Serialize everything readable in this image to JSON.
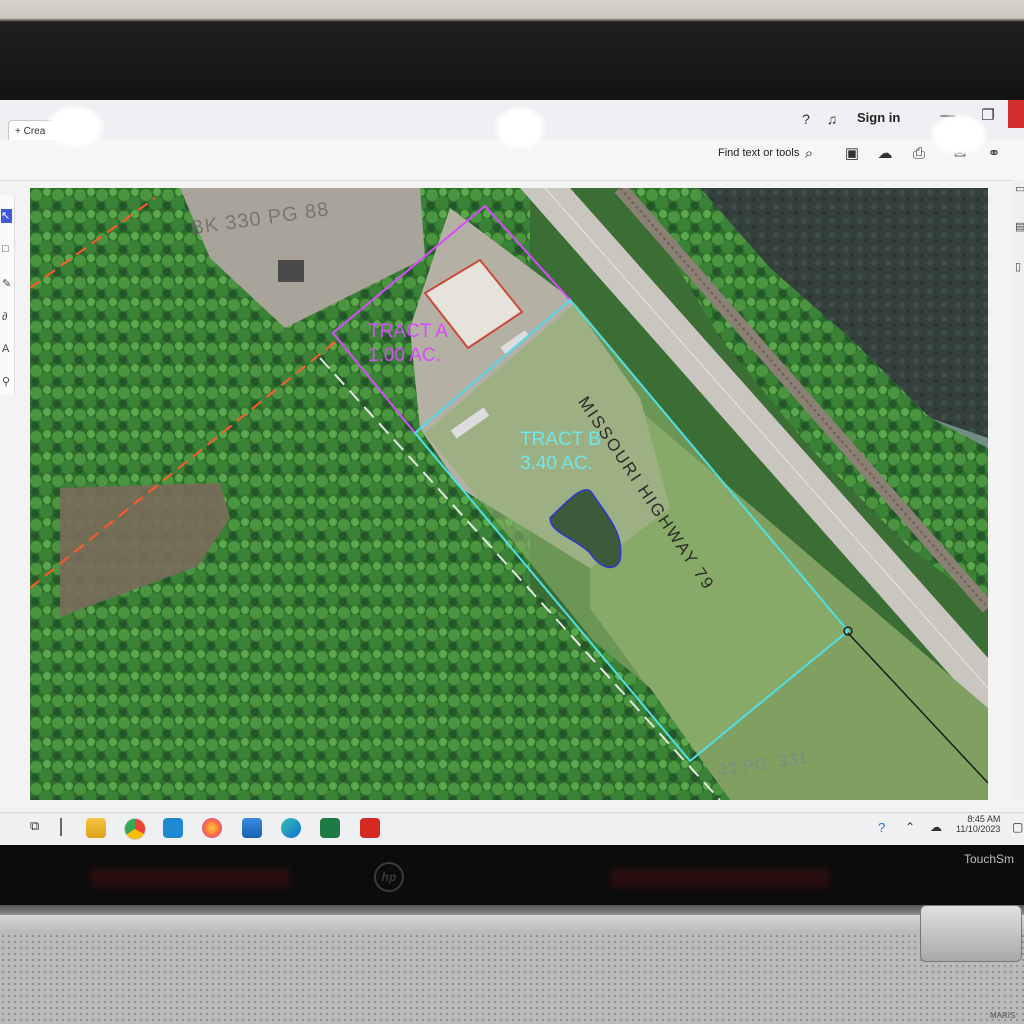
{
  "app": {
    "create_label": "+ Crea",
    "sign_in": "Sign in",
    "find_text": "Find text or tools"
  },
  "map": {
    "tract_a_name": "TRACT A",
    "tract_a_area": "1.00 AC.",
    "tract_b_name": "TRACT B",
    "tract_b_area": "3.40 AC.",
    "road_label": "MISSOURI HIGHWAY 79",
    "bk_label_top": "BK 330 PG 88",
    "bk_label_bottom": "33 PG. 331",
    "colors": {
      "tract_a": "#d84bff",
      "tract_b": "#4fe0e6",
      "pond": "#2a36d6",
      "property_line": "#ff5a2a"
    }
  },
  "taskbar": {
    "time": "8:45 AM",
    "date": "11/10/2023",
    "apps": [
      "task-view-icon",
      "file-explorer-icon",
      "chrome-icon",
      "store-icon",
      "firefox-icon",
      "remote-desktop-icon",
      "edge-icon",
      "excel-icon",
      "acrobat-icon"
    ]
  },
  "device": {
    "brand_text": "TouchSm",
    "logo": "hp",
    "watermark": "MARIS"
  }
}
